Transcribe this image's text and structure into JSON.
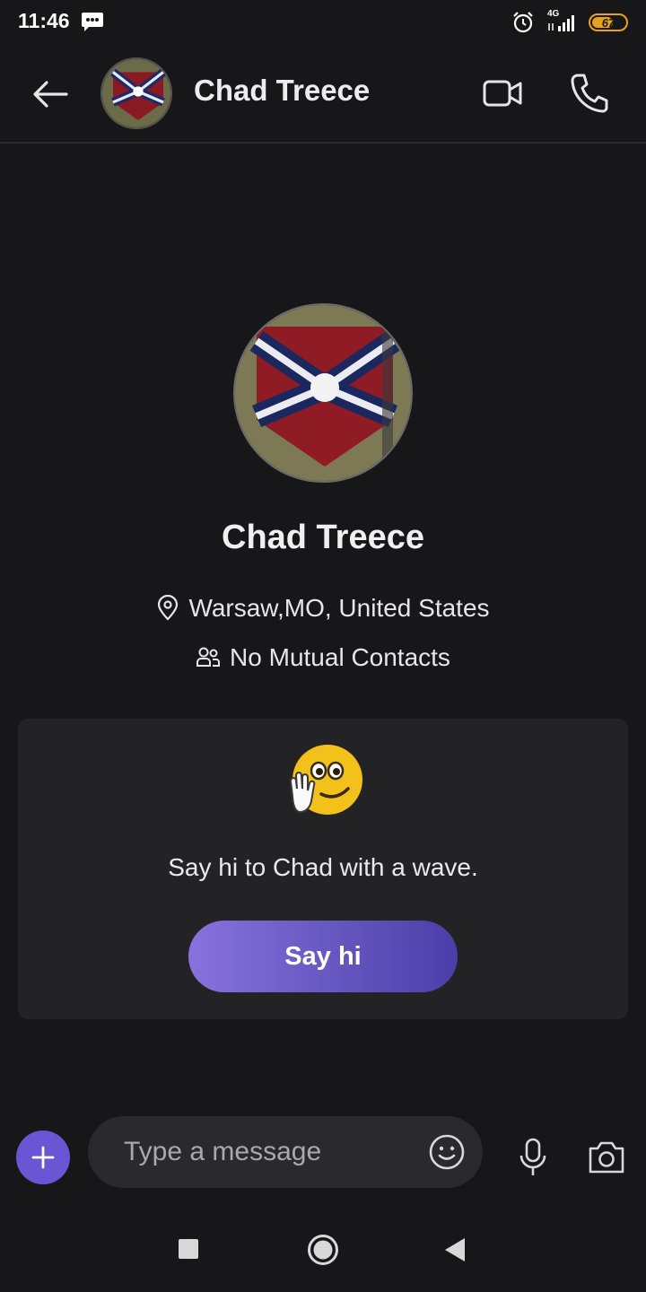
{
  "status_bar": {
    "time": "11:46",
    "network": "4G",
    "battery": "67",
    "battery_level_percent": 67,
    "icons": [
      "message-icon",
      "alarm-icon",
      "signal-icon",
      "battery-icon"
    ]
  },
  "header": {
    "title": "Chad Treece",
    "icons": [
      "back-arrow-icon",
      "video-camera-icon",
      "phone-icon"
    ]
  },
  "profile": {
    "name": "Chad Treece",
    "location": "Warsaw,MO, United States",
    "mutual_contacts": "No Mutual Contacts",
    "icons": [
      "location-pin-icon",
      "people-icon"
    ]
  },
  "wave_card": {
    "message": "Say hi to Chad with a wave.",
    "button_label": "Say hi",
    "emoji": "waving-smiley-icon"
  },
  "composer": {
    "placeholder": "Type a message",
    "icons": [
      "plus-icon",
      "smiley-icon",
      "microphone-icon",
      "camera-icon"
    ]
  },
  "nav_bar": {
    "icons": [
      "recents-square-icon",
      "home-circle-icon",
      "back-triangle-icon"
    ]
  },
  "colors": {
    "background": "#171719",
    "card": "#232326",
    "accent": "#6a56d4",
    "button_gradient_start": "#8673de",
    "button_gradient_end": "#4c3ea8",
    "battery": "#e8a11c"
  }
}
